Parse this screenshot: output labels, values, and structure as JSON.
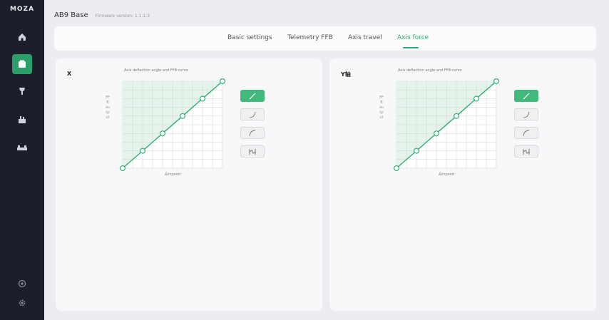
{
  "app": {
    "logo": "MOZA",
    "title": "AB9 Base",
    "firmware": "Firmware version: 1.1.1.3"
  },
  "sidebar": {
    "items": [
      {
        "icon": "home-icon"
      },
      {
        "icon": "base-icon",
        "active": true
      },
      {
        "icon": "joystick-icon"
      },
      {
        "icon": "throttle-icon"
      },
      {
        "icon": "pedals-icon"
      }
    ],
    "bottom": [
      {
        "icon": "settings-gear-icon"
      },
      {
        "icon": "gear-icon"
      }
    ]
  },
  "tabs": [
    {
      "label": "Basic settings"
    },
    {
      "label": "Telemetry FFB"
    },
    {
      "label": "Axis travel"
    },
    {
      "label": "Axis force",
      "active": true
    }
  ],
  "panels": [
    {
      "label": "X",
      "chart_title": "Axis deflection angle and FFB curve",
      "ylabel": "FFB output",
      "xlabel": "Airspeed",
      "buttons": [
        {
          "icon": "linear-curve-icon",
          "active": true
        },
        {
          "icon": "exponential-curve-icon"
        },
        {
          "icon": "logarithmic-curve-icon"
        },
        {
          "icon": "custom-curve-icon"
        }
      ]
    },
    {
      "label": "Y轴",
      "chart_title": "Axis deflection angle and FFB curve",
      "ylabel": "FFB output",
      "xlabel": "Airspeed",
      "buttons": [
        {
          "icon": "linear-curve-icon",
          "active": true
        },
        {
          "icon": "exponential-curve-icon"
        },
        {
          "icon": "logarithmic-curve-icon"
        },
        {
          "icon": "custom-curve-icon"
        }
      ]
    }
  ],
  "curve_points": [
    [
      0,
      0
    ],
    [
      20,
      20
    ],
    [
      40,
      40
    ],
    [
      60,
      60
    ],
    [
      80,
      80
    ],
    [
      100,
      100
    ]
  ],
  "colors": {
    "accent": "#2fae76",
    "grid_fill": "#e6f3ec",
    "sidebar": "#1c1e2c"
  }
}
